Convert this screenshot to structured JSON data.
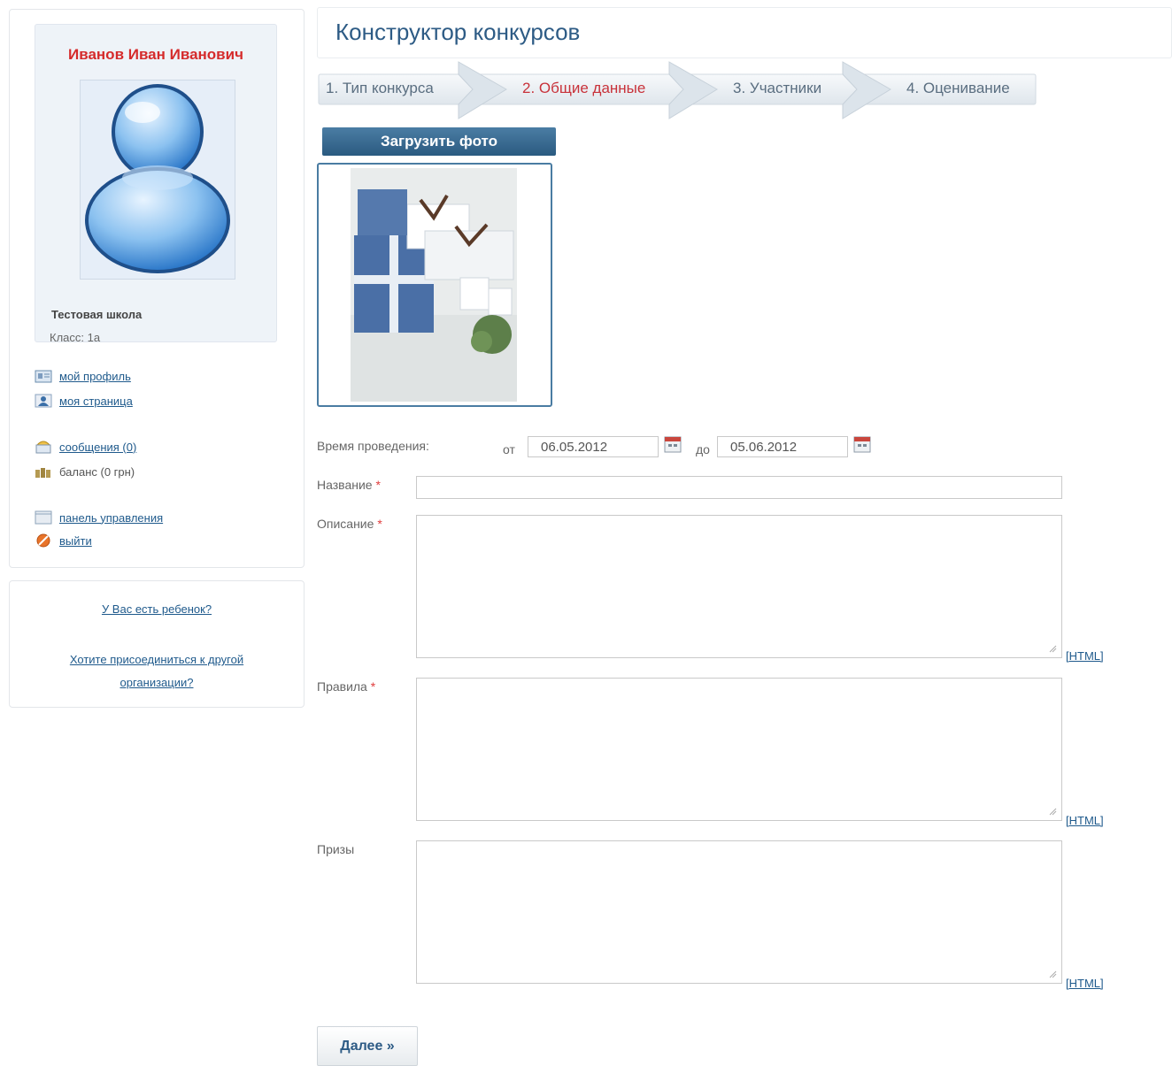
{
  "sidebar": {
    "user_name": "Иванов Иван Иванович",
    "school": "Тестовая школа",
    "class_line": "Класс: 1а",
    "menu": {
      "my_profile": "мой профиль",
      "my_page": "моя страница",
      "messages": "сообщения (0)",
      "balance": "баланс (0 грн)",
      "control_panel": "панель управления",
      "logout": "выйти"
    },
    "links": {
      "have_child": "У Вас есть ребенок?",
      "join_org_line1": "Хотите присоединиться к другой",
      "join_org_line2": "организации?"
    }
  },
  "main": {
    "title": "Конструктор конкурсов",
    "steps": [
      {
        "label": "1. Тип конкурса",
        "active": false
      },
      {
        "label": "2. Общие данные",
        "active": true
      },
      {
        "label": "3. Участники",
        "active": false
      },
      {
        "label": "4. Оценивание",
        "active": false
      }
    ],
    "upload_button": "Загрузить фото",
    "form": {
      "period_label": "Время проведения:",
      "from_label": "от",
      "from_value": "06.05.2012",
      "to_label": "до",
      "to_value": "05.06.2012",
      "name_label": "Название",
      "description_label": "Описание",
      "rules_label": "Правила",
      "prizes_label": "Призы",
      "required_mark": "*",
      "html_link": "[HTML]"
    },
    "next_button": "Далее »"
  },
  "colors": {
    "accent": "#2d5b85",
    "name_red": "#d52b2b",
    "active_step": "#c8323a",
    "link": "#1f5a8c"
  }
}
